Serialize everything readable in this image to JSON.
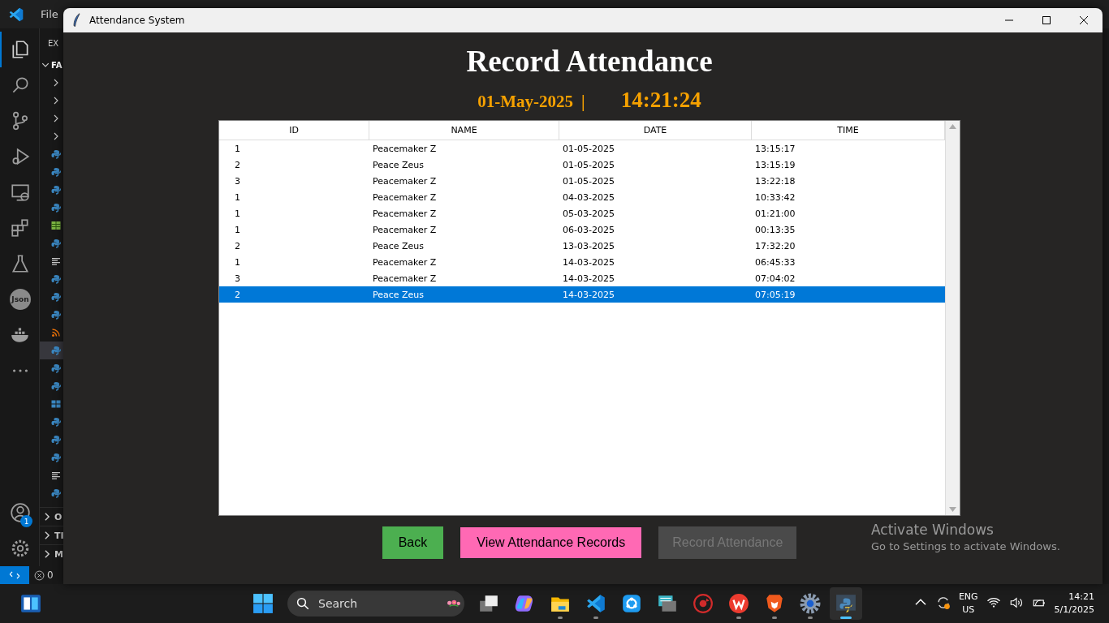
{
  "editor": {
    "menu": [
      "File"
    ],
    "activity_bar": [
      {
        "kind": "files",
        "selected": true
      },
      {
        "kind": "search",
        "selected": false
      },
      {
        "kind": "branch",
        "selected": false
      },
      {
        "kind": "debug",
        "selected": false
      },
      {
        "kind": "remote",
        "selected": false
      },
      {
        "kind": "extensions",
        "selected": false
      },
      {
        "kind": "flask",
        "selected": false
      },
      {
        "kind": "json",
        "label": "Json",
        "selected": false
      },
      {
        "kind": "docker",
        "selected": false
      },
      {
        "kind": "more",
        "selected": false
      }
    ],
    "accounts_badge": "1",
    "explorer": {
      "header": "EX",
      "section": "FA",
      "items": [
        {
          "kind": "folder",
          "selected": false
        },
        {
          "kind": "folder",
          "selected": false
        },
        {
          "kind": "folder",
          "selected": false
        },
        {
          "kind": "folder",
          "selected": false
        },
        {
          "kind": "python",
          "selected": false
        },
        {
          "kind": "python",
          "selected": false
        },
        {
          "kind": "python",
          "selected": false
        },
        {
          "kind": "python",
          "selected": false
        },
        {
          "kind": "sheet",
          "selected": false
        },
        {
          "kind": "python",
          "selected": false
        },
        {
          "kind": "text",
          "selected": false
        },
        {
          "kind": "python",
          "selected": false
        },
        {
          "kind": "python",
          "selected": false
        },
        {
          "kind": "python",
          "selected": false
        },
        {
          "kind": "rss",
          "selected": false
        },
        {
          "kind": "python",
          "selected": true
        },
        {
          "kind": "python",
          "selected": false
        },
        {
          "kind": "python",
          "selected": false
        },
        {
          "kind": "windows",
          "selected": false
        },
        {
          "kind": "python",
          "selected": false
        },
        {
          "kind": "python",
          "selected": false
        },
        {
          "kind": "python",
          "selected": false
        },
        {
          "kind": "text",
          "selected": false
        },
        {
          "kind": "python",
          "selected": false
        }
      ],
      "panels": [
        "O",
        "TI",
        "M"
      ]
    },
    "status_bar": {
      "problems": "0"
    }
  },
  "window": {
    "title": "Attendance System",
    "heading": "Record Attendance",
    "date": "01-May-2025",
    "separator": "|",
    "clock": "14:21:24",
    "table": {
      "columns": [
        "ID",
        "NAME",
        "DATE",
        "TIME"
      ],
      "rows": [
        {
          "cells": [
            "1",
            "Peacemaker Z",
            "01-05-2025",
            "13:15:17"
          ],
          "selected": false
        },
        {
          "cells": [
            "2",
            "Peace Zeus",
            "01-05-2025",
            "13:15:19"
          ],
          "selected": false
        },
        {
          "cells": [
            "3",
            "Peacemaker Z",
            "01-05-2025",
            "13:22:18"
          ],
          "selected": false
        },
        {
          "cells": [
            "1",
            "Peacemaker Z",
            "04-03-2025",
            "10:33:42"
          ],
          "selected": false
        },
        {
          "cells": [
            "1",
            "Peacemaker Z",
            "05-03-2025",
            "01:21:00"
          ],
          "selected": false
        },
        {
          "cells": [
            "1",
            "Peacemaker Z",
            "06-03-2025",
            "00:13:35"
          ],
          "selected": false
        },
        {
          "cells": [
            "2",
            "Peace Zeus",
            "13-03-2025",
            "17:32:20"
          ],
          "selected": false
        },
        {
          "cells": [
            "1",
            "Peacemaker Z",
            "14-03-2025",
            "06:45:33"
          ],
          "selected": false
        },
        {
          "cells": [
            "3",
            "Peacemaker Z",
            "14-03-2025",
            "07:04:02"
          ],
          "selected": false
        },
        {
          "cells": [
            "2",
            "Peace Zeus",
            "14-03-2025",
            "07:05:19"
          ],
          "selected": true
        }
      ]
    },
    "buttons": [
      {
        "label": "Back",
        "kind": "back",
        "disabled": false
      },
      {
        "label": "View Attendance Records",
        "kind": "view",
        "disabled": false
      },
      {
        "label": "Record Attendance",
        "kind": "record",
        "disabled": true
      }
    ]
  },
  "activation_notice": {
    "title": "Activate Windows",
    "text": "Go to Settings to activate Windows."
  },
  "taskbar": {
    "search": {
      "placeholder": "Search"
    },
    "apps": [
      {
        "kind": "taskview",
        "running": false,
        "active": false
      },
      {
        "kind": "copilot",
        "running": false,
        "active": false
      },
      {
        "kind": "folder",
        "running": true,
        "active": false
      },
      {
        "kind": "vscode",
        "running": true,
        "active": false
      },
      {
        "kind": "share",
        "running": false,
        "active": false
      },
      {
        "kind": "keyboard",
        "running": false,
        "active": false
      },
      {
        "kind": "driver",
        "running": false,
        "active": false
      },
      {
        "kind": "office",
        "running": true,
        "active": false
      },
      {
        "kind": "brave",
        "running": true,
        "active": false
      },
      {
        "kind": "gear",
        "running": true,
        "active": false
      },
      {
        "kind": "python",
        "running": true,
        "active": true
      }
    ],
    "language": [
      "ENG",
      "US"
    ],
    "time": "14:21",
    "date": "5/1/2025"
  }
}
